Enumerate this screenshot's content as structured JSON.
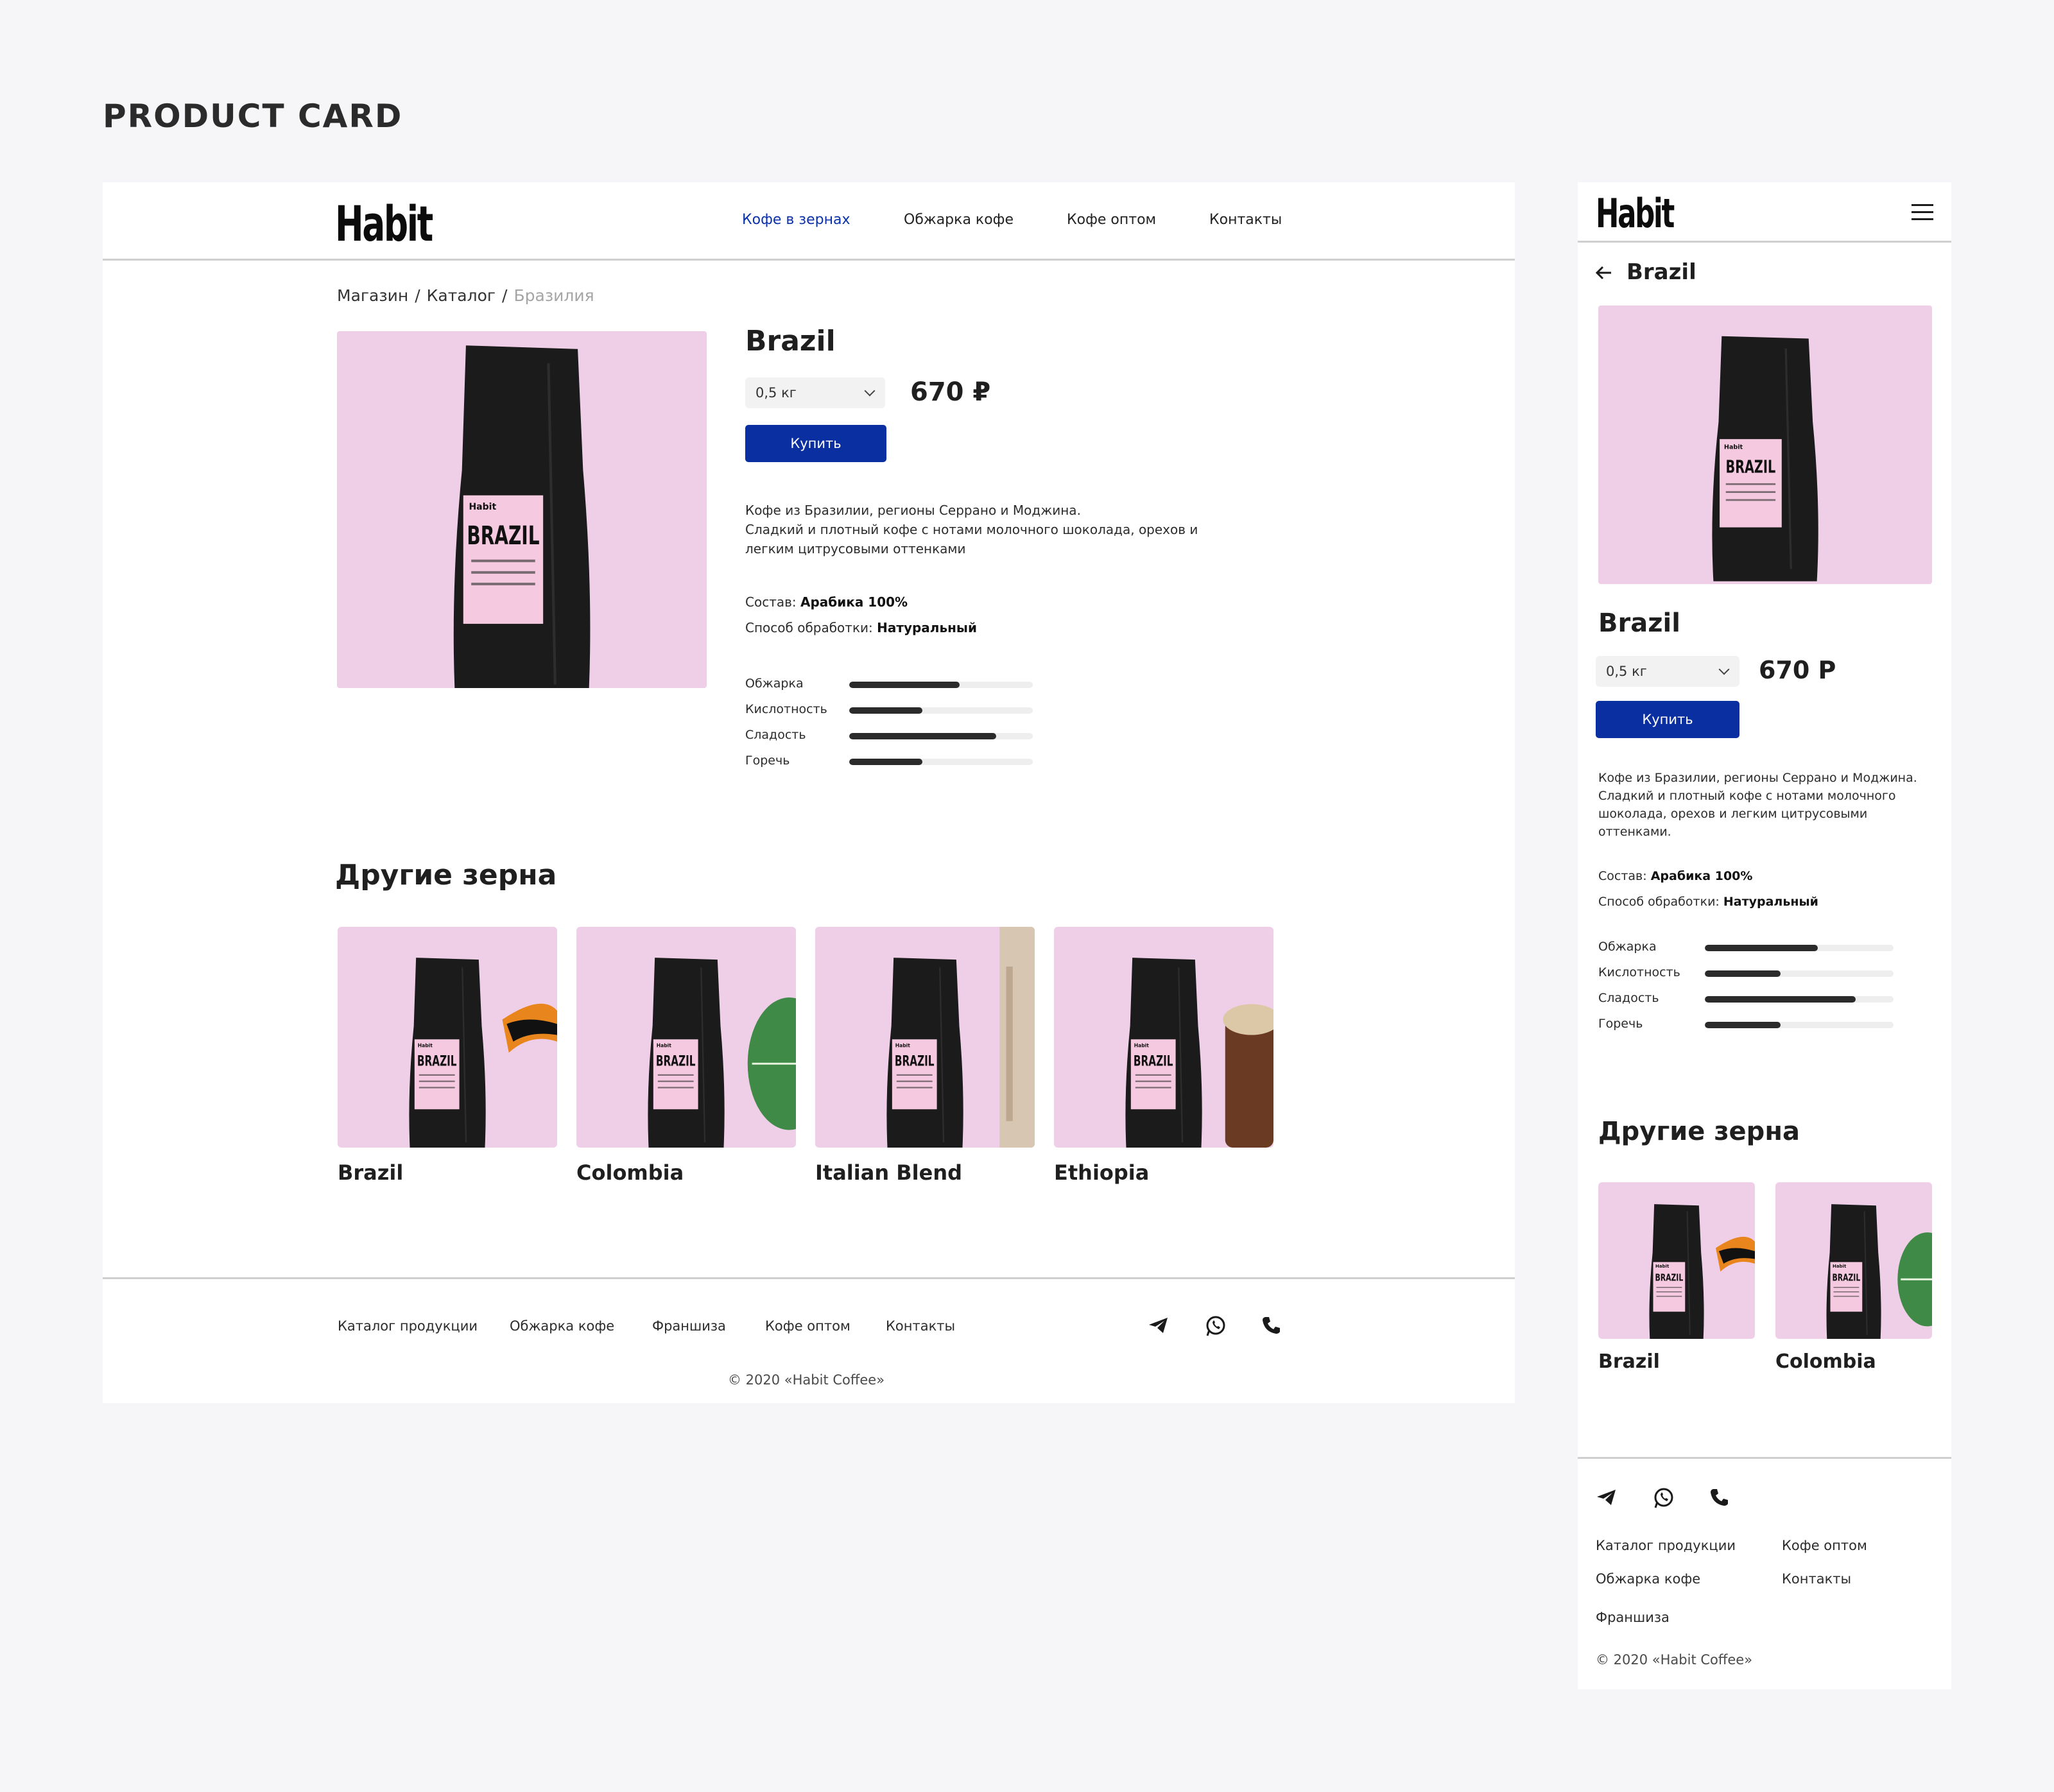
{
  "page_heading": "PRODUCT CARD",
  "brand": {
    "logo": "Habit"
  },
  "nav": [
    {
      "label": "Кофе в зернах",
      "active": true
    },
    {
      "label": "Обжарка кофе",
      "active": false
    },
    {
      "label": "Кофе оптом",
      "active": false
    },
    {
      "label": "Контакты",
      "active": false
    }
  ],
  "breadcrumb": {
    "items": [
      "Магазин",
      "Каталог"
    ],
    "current": "Бразилия",
    "separator": "/"
  },
  "product": {
    "name": "Brazil",
    "weight": "0,5 кг",
    "price": "670 ₽",
    "price_mobile": "670 Р",
    "buy_label": "Купить",
    "description_lines": [
      "Кофе из Бразилии, регионы Серрано и Моджина.",
      "Сладкий и плотный кофе с нотами молочного шоколада, орехов и",
      "легким цитрусовыми оттенками"
    ],
    "description_lines_mobile": [
      "Кофе из Бразилии, регионы Серрано и Моджина.",
      "Сладкий и плотный кофе с нотами молочного",
      "шоколада, орехов и легким цитрусовыми",
      "оттенками."
    ],
    "composition_label": "Состав:",
    "composition_value": "Арабика 100%",
    "process_label": "Способ обработки:",
    "process_value": "Натуральный",
    "attributes": [
      {
        "label": "Обжарка",
        "level": 0.6
      },
      {
        "label": "Кислотность",
        "level": 0.4
      },
      {
        "label": "Сладость",
        "level": 0.8
      },
      {
        "label": "Горечь",
        "level": 0.4
      }
    ],
    "bag_label": "BRAZIL",
    "bag_brand": "Habit"
  },
  "others": {
    "title": "Другие зерна",
    "items": [
      {
        "name": "Brazil",
        "decor": "toucan"
      },
      {
        "name": "Colombia",
        "decor": "monstera-leaf"
      },
      {
        "name": "Italian Blend",
        "decor": "column"
      },
      {
        "name": "Ethiopia",
        "decor": "drum"
      }
    ]
  },
  "footer": {
    "links": [
      "Каталог продукции",
      "Обжарка кофе",
      "Франшиза",
      "Кофе оптом",
      "Контакты"
    ],
    "social": [
      "telegram-icon",
      "whatsapp-icon",
      "phone-icon"
    ],
    "copyright": "© 2020 «Habit Coffee»"
  },
  "colors": {
    "accent": "#0a2fa0",
    "nav_active": "#0b31a8",
    "card_pink": "#efcfe7",
    "bag": "#1b1b1b",
    "label_pink": "#f5c9df"
  }
}
